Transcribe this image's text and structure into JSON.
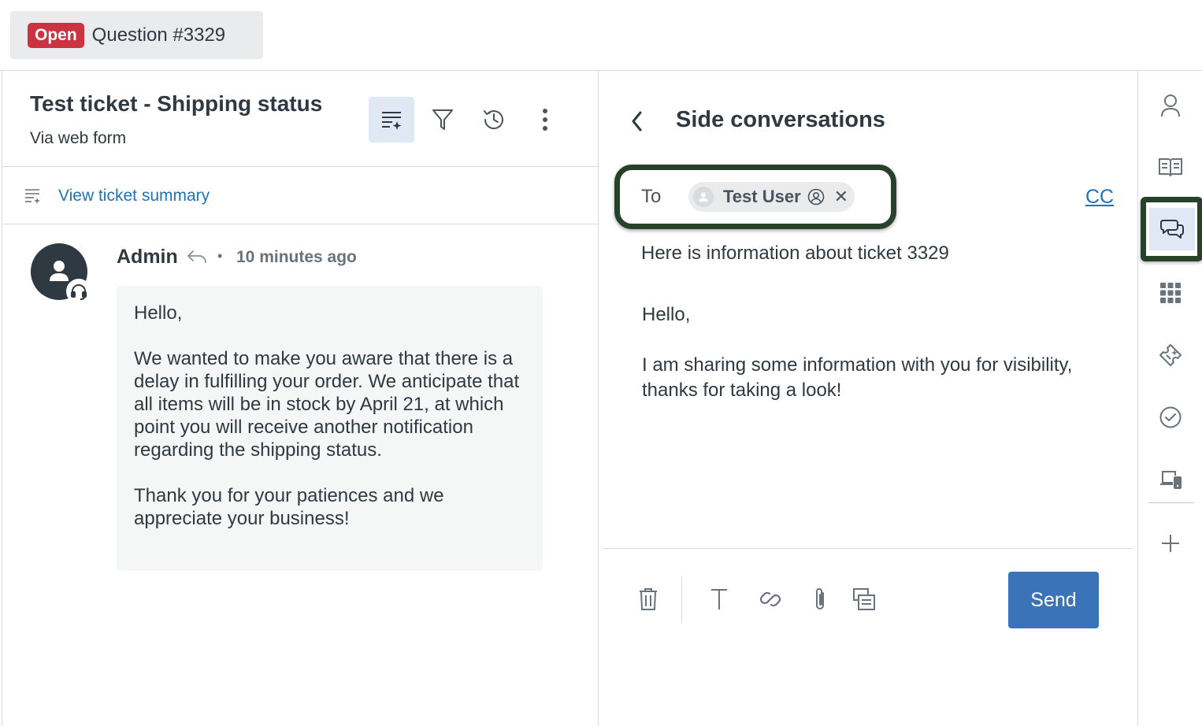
{
  "tab": {
    "status": "Open",
    "title": "Question #3329",
    "status_color": "#cc3340"
  },
  "ticket": {
    "title": "Test ticket - Shipping status",
    "channel": "Via web form",
    "header_actions": [
      "summary-icon",
      "filter-icon",
      "history-icon",
      "more-options-icon"
    ],
    "summary_link": "View ticket summary"
  },
  "message": {
    "author": "Admin",
    "separator": "•",
    "time": "10 minutes ago",
    "paragraphs": [
      "Hello,",
      "We wanted to make you aware that there is a delay in fulfilling your order. We anticipate that all items will be in stock by April 21, at which point you will receive another notification regarding the shipping status.",
      "Thank you for your patiences and we appreciate your business!"
    ]
  },
  "side": {
    "title": "Side conversations",
    "to_label": "To",
    "recipient": "Test User",
    "remove_glyph": "✕",
    "cc_label": "CC",
    "subject": "Here is information about ticket 3329",
    "body": [
      "Hello,",
      "I am sharing some information with you for visibility, thanks for taking a look!"
    ],
    "toolbar": [
      "trash-icon",
      "text-format-icon",
      "link-icon",
      "attachment-icon",
      "macro-icon"
    ],
    "send_label": "Send",
    "send_color": "#3b73b9"
  },
  "rail": {
    "items": [
      "user-icon",
      "knowledge-icon",
      "side-conversations-icon",
      "apps-icon",
      "ticket-icon",
      "tasks-icon",
      "devices-icon",
      "add-icon"
    ],
    "highlight_color": "#28412a"
  }
}
